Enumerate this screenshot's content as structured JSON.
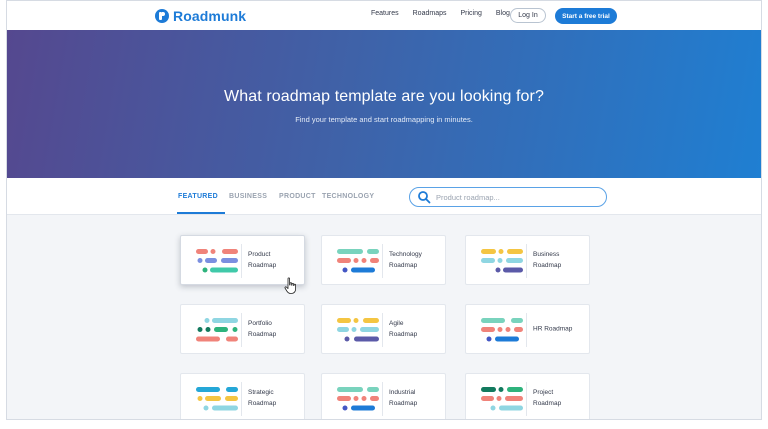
{
  "brand": {
    "name": "Roadmunk"
  },
  "nav": {
    "links": [
      "Features",
      "Roadmaps",
      "Pricing",
      "Blog"
    ],
    "login": "Log In",
    "trial": "Start a free trial"
  },
  "hero": {
    "title": "What roadmap template are you looking for?",
    "subtitle": "Find your template and start roadmapping in minutes."
  },
  "tabs": [
    {
      "label": "FEATURED",
      "active": true
    },
    {
      "label": "BUSINESS",
      "active": false
    },
    {
      "label": "PRODUCT",
      "active": false
    },
    {
      "label": "TECHNOLOGY",
      "active": false
    }
  ],
  "search": {
    "placeholder": "Product roadmap...",
    "value": ""
  },
  "colors": {
    "brand": "#1d7bd7",
    "salmon": "#f0837a",
    "periwinkle": "#7b8fe0",
    "teal": "#40c9a9",
    "green": "#2eb37c",
    "navy": "#4457c4",
    "blue": "#1d7bd7",
    "yellow": "#f4c542",
    "purple": "#5b5aa8",
    "lightblue": "#8fd6e2",
    "darkgreen": "#127a5e",
    "mint": "#79d3bd",
    "sky": "#25a7d7"
  },
  "cards": [
    {
      "line1": "Product",
      "line2": "Roadmap",
      "icon": "product-roadmap-icon"
    },
    {
      "line1": "Technology",
      "line2": "Roadmap",
      "icon": "technology-roadmap-icon"
    },
    {
      "line1": "Business",
      "line2": "Roadmap",
      "icon": "business-roadmap-icon"
    },
    {
      "line1": "Portfolio",
      "line2": "Roadmap",
      "icon": "portfolio-roadmap-icon"
    },
    {
      "line1": "Agile",
      "line2": "Roadmap",
      "icon": "agile-roadmap-icon"
    },
    {
      "line1": "HR Roadmap",
      "line2": "",
      "icon": "hr-roadmap-icon"
    },
    {
      "line1": "Strategic",
      "line2": "Roadmap",
      "icon": "strategic-roadmap-icon"
    },
    {
      "line1": "Industrial",
      "line2": "Roadmap",
      "icon": "industrial-roadmap-icon"
    },
    {
      "line1": "Project",
      "line2": "Roadmap",
      "icon": "project-roadmap-icon"
    }
  ]
}
